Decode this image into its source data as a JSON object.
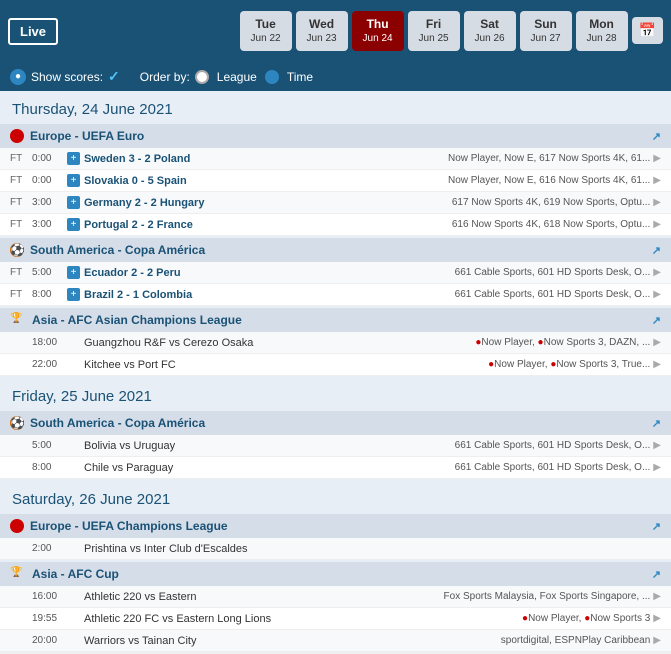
{
  "topbar": {
    "live_label": "Live",
    "days": [
      {
        "name": "Tue",
        "date": "Jun 22",
        "active": false
      },
      {
        "name": "Wed",
        "date": "Jun 23",
        "active": false
      },
      {
        "name": "Thu",
        "date": "Jun 24",
        "active": true
      },
      {
        "name": "Fri",
        "date": "Jun 25",
        "active": false
      },
      {
        "name": "Sat",
        "date": "Jun 26",
        "active": false
      },
      {
        "name": "Sun",
        "date": "Jun 27",
        "active": false
      },
      {
        "name": "Mon",
        "date": "Jun 28",
        "active": false
      }
    ]
  },
  "filter": {
    "show_scores_label": "Show scores:",
    "order_by_label": "Order by:",
    "league_label": "League",
    "time_label": "Time"
  },
  "sections": [
    {
      "date_header": "Thursday, 24 June 2021",
      "leagues": [
        {
          "id": "europe-euro",
          "icon_color": "#cc0000",
          "icon_type": "red-circle",
          "name": "Europe - UEFA Euro",
          "matches": [
            {
              "status": "FT",
              "time": "0:00",
              "has_plus": true,
              "name": "Sweden 3 - 2 Poland",
              "channels": "Now Player, Now E, 617 Now Sports 4K, 61..."
            },
            {
              "status": "FT",
              "time": "0:00",
              "has_plus": true,
              "name": "Slovakia 0 - 5 Spain",
              "channels": "Now Player, Now E, 616 Now Sports 4K, 61..."
            },
            {
              "status": "FT",
              "time": "3:00",
              "has_plus": true,
              "name": "Germany 2 - 2 Hungary",
              "channels": "617 Now Sports 4K, 619 Now Sports, Optu..."
            },
            {
              "status": "FT",
              "time": "3:00",
              "has_plus": true,
              "name": "Portugal 2 - 2 France",
              "channels": "616 Now Sports 4K, 618 Now Sports, Optu..."
            }
          ]
        },
        {
          "id": "south-america-copa",
          "icon_color": "#cc6600",
          "icon_type": "ball",
          "name": "South America - Copa América",
          "matches": [
            {
              "status": "FT",
              "time": "5:00",
              "has_plus": true,
              "name": "Ecuador 2 - 2 Peru",
              "channels": "661 Cable Sports, 601 HD Sports Desk, O..."
            },
            {
              "status": "FT",
              "time": "8:00",
              "has_plus": true,
              "name": "Brazil 2 - 1 Colombia",
              "channels": "661 Cable Sports, 601 HD Sports Desk, O..."
            }
          ]
        },
        {
          "id": "asia-afc-champions",
          "icon_color": "#1a6699",
          "icon_type": "afc",
          "name": "Asia - AFC Asian Champions League",
          "matches": [
            {
              "status": "",
              "time": "18:00",
              "has_plus": false,
              "name": "Guangzhou R&F vs Cerezo Osaka",
              "channels": "🔴Now Player, 🔴Now Sports 3, DAZN, ...",
              "has_dots": true,
              "dot_channels": [
                "Now Player",
                "Now Sports 3"
              ],
              "rest": "DAZN, ..."
            },
            {
              "status": "",
              "time": "22:00",
              "has_plus": false,
              "name": "Kitchee vs Port FC",
              "channels": "🔴Now Player, 🔴Now Sports 3, True...",
              "has_dots": true,
              "dot_channels": [
                "Now Player",
                "Now Sports 3"
              ],
              "rest": "True..."
            }
          ]
        }
      ]
    },
    {
      "date_header": "Friday, 25 June 2021",
      "leagues": [
        {
          "id": "south-america-copa-fri",
          "icon_color": "#cc6600",
          "icon_type": "ball",
          "name": "South America - Copa América",
          "matches": [
            {
              "status": "",
              "time": "5:00",
              "has_plus": false,
              "name": "Bolivia vs Uruguay",
              "channels": "661 Cable Sports, 601 HD Sports Desk, O..."
            },
            {
              "status": "",
              "time": "8:00",
              "has_plus": false,
              "name": "Chile vs Paraguay",
              "channels": "661 Cable Sports, 601 HD Sports Desk, O..."
            }
          ]
        }
      ]
    },
    {
      "date_header": "Saturday, 26 June 2021",
      "leagues": [
        {
          "id": "europe-champions-sat",
          "icon_color": "#cc0000",
          "icon_type": "red-circle",
          "name": "Europe - UEFA Champions League",
          "matches": [
            {
              "status": "",
              "time": "2:00",
              "has_plus": false,
              "name": "Prishtina vs Inter Club d'Escaldes",
              "channels": ""
            }
          ]
        },
        {
          "id": "asia-afc-cup-sat",
          "icon_color": "#1a6699",
          "icon_type": "afc",
          "name": "Asia - AFC Cup",
          "matches": [
            {
              "status": "",
              "time": "16:00",
              "has_plus": false,
              "name": "Athletic 220 vs Eastern",
              "channels": "Fox Sports Malaysia, Fox Sports Singapore, ..."
            },
            {
              "status": "",
              "time": "19:55",
              "has_plus": false,
              "name": "Athletic 220 FC vs Eastern Long Lions",
              "channels": "🔴Now Player, 🔴Now Sports 3",
              "has_dots": true,
              "dot_channels": [
                "Now Player",
                "Now Sports 3"
              ],
              "rest": ""
            },
            {
              "status": "",
              "time": "20:00",
              "has_plus": false,
              "name": "Warriors vs Tainan City",
              "channels": "sportdigital, ESPNPlay Caribbean"
            }
          ]
        }
      ]
    }
  ]
}
